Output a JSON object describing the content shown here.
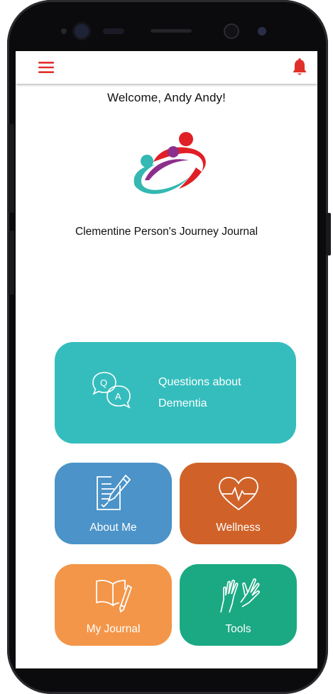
{
  "header": {
    "menu_icon": "hamburger-menu-icon",
    "notification_icon": "bell-icon",
    "accent_color": "#e0302a"
  },
  "welcome_text": "Welcome, Andy Andy!",
  "logo_icon": "clementine-people-logo",
  "journal_title": "Clementine Person's Journey Journal",
  "tiles": {
    "questions": {
      "line1": "Questions about",
      "line2": "Dementia",
      "icon": "q-and-a-bubbles-icon",
      "color": "#35bdbd"
    },
    "about_me": {
      "label": "About Me",
      "icon": "notepad-pen-icon",
      "color": "#4b93c8"
    },
    "wellness": {
      "label": "Wellness",
      "icon": "heart-pulse-icon",
      "color": "#d06229"
    },
    "my_journal": {
      "label": "My Journal",
      "icon": "open-book-pen-icon",
      "color": "#f39649"
    },
    "tools": {
      "label": "Tools",
      "icon": "helping-hands-icon",
      "color": "#1ba983"
    }
  }
}
